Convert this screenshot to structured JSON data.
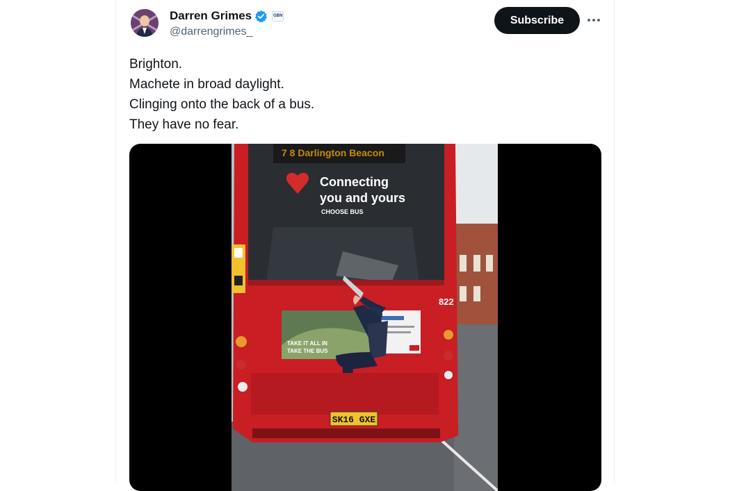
{
  "author": {
    "display_name": "Darren Grimes",
    "handle": "@darrengrimes_",
    "affiliation_badge": "GBN",
    "verified_color": "#1d9bf0"
  },
  "actions": {
    "subscribe_label": "Subscribe",
    "more_icon": "more-horizontal-icon"
  },
  "tweet": {
    "lines": [
      "Brighton.",
      "Machete in broad daylight.",
      "Clinging onto the back of a bus.",
      "They have no fear."
    ]
  },
  "media": {
    "type": "video",
    "bus_ad_line1": "Connecting",
    "bus_ad_line2": "you and yours",
    "bus_ad_line3": "CHOOSE BUS",
    "rear_ad_line1": "TAKE IT ALL IN",
    "rear_ad_line2": "TAKE THE BUS",
    "fleet_number": "822",
    "plate": "SK16 GXE"
  },
  "colors": {
    "bus_red": "#c81e24",
    "accent": "#1d9bf0",
    "button_bg": "#0f1419"
  }
}
